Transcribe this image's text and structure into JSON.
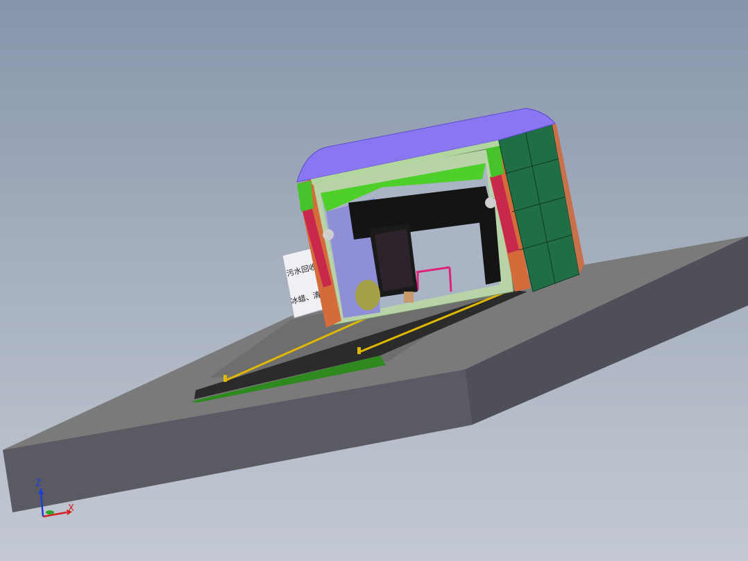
{
  "viewport": {
    "background_top": "#8795ab",
    "background_bottom": "#c4c9d3"
  },
  "sign": {
    "line1": "污水回收过",
    "line2": "冰蜡、清洁"
  },
  "triad": {
    "x_label": "X",
    "y_label": "Y",
    "z_label": "Z",
    "x_color": "#d42020",
    "y_color": "#2fa52f",
    "z_color": "#1f3fd0"
  },
  "colors": {
    "base_top": "#777777",
    "base_side": "#555560",
    "canopy": "#8a76f0",
    "frame": "#b6d6a8",
    "side_panel": "#1f6e45",
    "ramp": "#2f2f2f",
    "rails": "#e0b800",
    "pink_pipe": "#e0207a"
  }
}
